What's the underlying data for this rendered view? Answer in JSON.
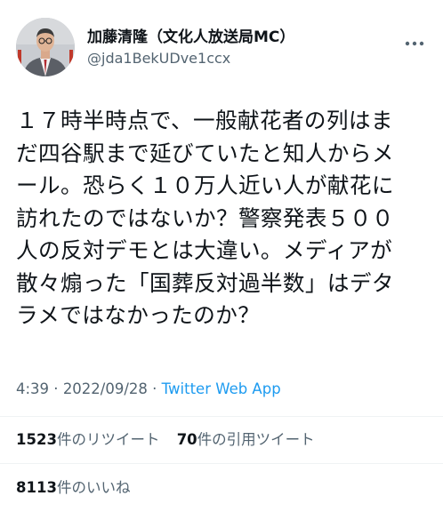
{
  "tweet": {
    "author": {
      "display_name": "加藤清隆（文化人放送局MC）",
      "handle": "@jda1BekUDve1ccx",
      "avatar_icon": "person-avatar-icon"
    },
    "more_icon": "ellipsis-icon",
    "text_lines": [
      "１７時半時点で、一般献花者の列はま",
      "だ四谷駅まで延びていたと知人からメ",
      "ール。恐らく１０万人近い人が献花に",
      "訪れたのではないか？警察発表５００",
      "人の反対デモとは大違い。メディアが",
      "散々煽った「国葬反対過半数」はデタ",
      "ラメではなかったのか？"
    ],
    "time": "4:39",
    "separator": " · ",
    "date": "2022/09/28",
    "source": "Twitter Web App",
    "stats": {
      "retweets_count": "1523",
      "retweets_label": "件のリツイート",
      "quotes_count": "70",
      "quotes_label": "件の引用ツイート",
      "likes_count": "8113",
      "likes_label": "件のいいね"
    }
  },
  "colors": {
    "text_primary": "#0f1419",
    "text_secondary": "#536471",
    "link": "#1d9bf0",
    "divider": "#eff3f4"
  }
}
